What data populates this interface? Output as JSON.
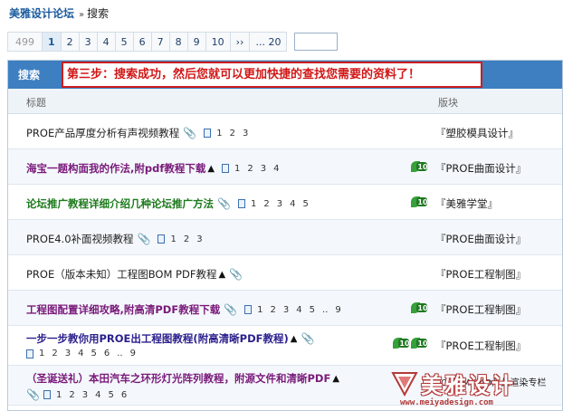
{
  "breadcrumb": {
    "site": "美雅设计论坛",
    "sep": "»",
    "current": "搜索"
  },
  "pager": {
    "items": [
      "499",
      "1",
      "2",
      "3",
      "4",
      "5",
      "6",
      "7",
      "8",
      "9",
      "10",
      "››",
      "... 20"
    ],
    "active": "1"
  },
  "table": {
    "header_title": "搜索",
    "callout": "第三步：搜索成功，然后您就可以更加快捷的查找您需要的资料了！",
    "col_title": "标题",
    "col_board": "版块",
    "rows": [
      {
        "title": "PROE产品厚度分析有声视频教程",
        "style": "normal",
        "pages": [
          "1",
          "2",
          "3"
        ],
        "board": "『塑胶模具设计』"
      },
      {
        "title": "海宝一题构面我的作法,附pdf教程下载",
        "style": "purple",
        "pages": [
          "1",
          "2",
          "3",
          "4"
        ],
        "board": "『PROE曲面设计』"
      },
      {
        "title": "论坛推广教程详细介绍几种论坛推广方法",
        "style": "green",
        "pages": [
          "1",
          "2",
          "3",
          "4",
          "5"
        ],
        "board": "『美雅学堂』"
      },
      {
        "title": "PROE4.0补面视频教程",
        "style": "normal",
        "pages": [
          "1",
          "2",
          "3"
        ],
        "board": "『PROE曲面设计』"
      },
      {
        "title": "PROE（版本未知）工程图BOM PDF教程",
        "style": "normal",
        "pages": [],
        "board": "『PROE工程制图』"
      },
      {
        "title": "工程图配置详细攻略,附高清PDF教程下载",
        "style": "purple",
        "pages": [
          "1",
          "2",
          "3",
          "4",
          "5",
          "..",
          "9"
        ],
        "board": "『PROE工程制图』"
      },
      {
        "title": "一步一步教你用PROE出工程图教程(附高清晰PDF教程)",
        "style": "navy",
        "pages": [
          "1",
          "2",
          "3",
          "4",
          "5",
          "6",
          "..",
          "9"
        ],
        "board": "『PROE工程制图』"
      },
      {
        "title": "（圣诞送礼）本田汽车之环形灯光阵列教程，附源文件和清晰PDF",
        "style": "purple",
        "pages": [
          "1",
          "2",
          "3",
          "4",
          "5",
          "6"
        ],
        "board": "CINEMA 4D产品渲染专栏"
      }
    ]
  },
  "badge_text": "10",
  "watermark": {
    "name": "美雅设计",
    "url": "www.meiyadesign.com"
  }
}
